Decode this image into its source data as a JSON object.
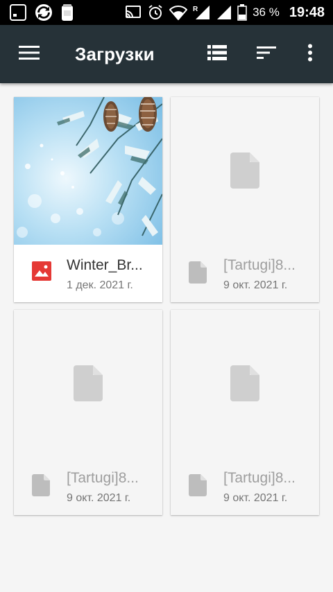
{
  "status_bar": {
    "icons": [
      "notification-icon",
      "sync-icon",
      "sim-card-icon",
      "cast-icon",
      "alarm-icon",
      "wifi-icon",
      "signal-roaming-icon",
      "signal-icon",
      "battery-icon"
    ],
    "roaming_label": "R",
    "battery": "36 %",
    "time": "19:48"
  },
  "toolbar": {
    "title": "Загрузки",
    "icons": [
      "menu-icon",
      "list-view-icon",
      "sort-icon",
      "more-vert-icon"
    ],
    "background": "#263238"
  },
  "files": [
    {
      "name": "Winter_Br...",
      "date": "1 дек. 2021 г.",
      "kind": "image",
      "icon": "image-file-icon",
      "icon_color": "#e53935"
    },
    {
      "name": "[Tartugi]8...",
      "date": "9 окт. 2021 г.",
      "kind": "document",
      "icon": "document-file-icon"
    },
    {
      "name": "[Tartugi]8...",
      "date": "9 окт. 2021 г.",
      "kind": "document",
      "icon": "document-file-icon"
    },
    {
      "name": "[Tartugi]8...",
      "date": "9 окт. 2021 г.",
      "kind": "document",
      "icon": "document-file-icon"
    }
  ]
}
